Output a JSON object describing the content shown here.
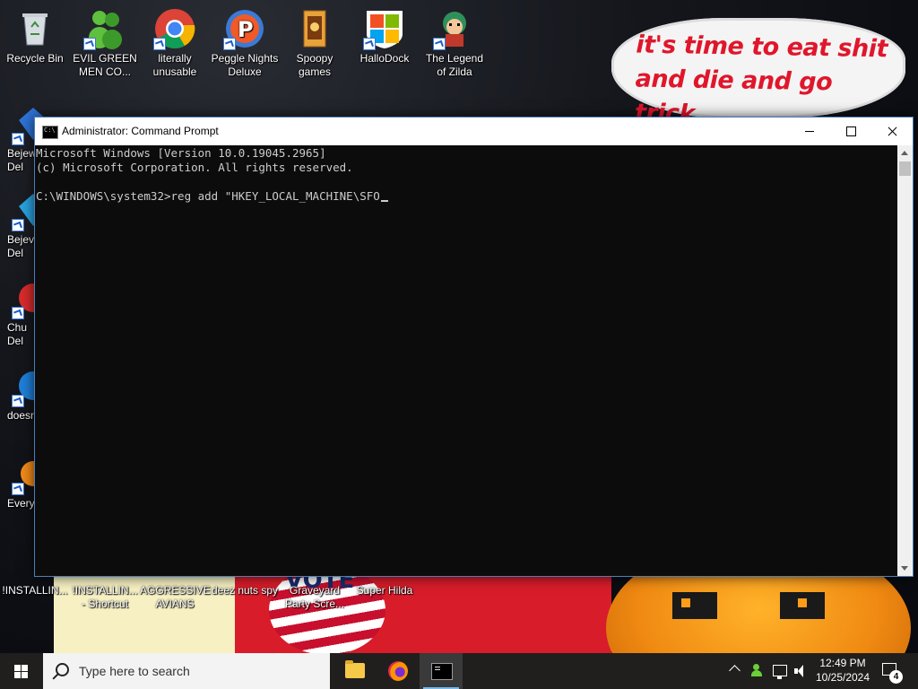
{
  "wallpaper": {
    "speech_text": "it's time to eat shit\nand die and go trick\nor treating and vote!",
    "vote_text": "VOTE"
  },
  "desktop": {
    "top_icons": [
      {
        "label": "Recycle Bin",
        "icon": "recycle-bin-icon"
      },
      {
        "label": "EVIL GREEN\nMEN CO...",
        "icon": "green-men-icon"
      },
      {
        "label": "literally\nunusable",
        "icon": "chrome-icon"
      },
      {
        "label": "Peggle Nights\nDeluxe",
        "icon": "peggle-icon"
      },
      {
        "label": "Spoopy\ngames",
        "icon": "games-folder-icon"
      },
      {
        "label": "HalloDock",
        "icon": "windows-logo-icon"
      },
      {
        "label": "The Legend\nof Zilda",
        "icon": "zilda-icon"
      }
    ],
    "left_icons": [
      {
        "label": "Bejew\nDel"
      },
      {
        "label": "Bejev\nDel"
      },
      {
        "label": "Chu\nDel"
      },
      {
        "label": "doesn"
      },
      {
        "label": "Every"
      }
    ],
    "bottom_icons": [
      {
        "label": "!INSTALLIN..."
      },
      {
        "label": "!INSTALLIN...\n- Shortcut"
      },
      {
        "label": "AGGRESSIVE\nAVIANS"
      },
      {
        "label": "deez nuts spy"
      },
      {
        "label": "Graveyard\nParty Scre..."
      },
      {
        "label": "Super Hilda"
      }
    ]
  },
  "cmd": {
    "title": "Administrator: Command Prompt",
    "lines": [
      "Microsoft Windows [Version 10.0.19045.2965]",
      "(c) Microsoft Corporation. All rights reserved.",
      "",
      "C:\\WINDOWS\\system32>reg add \"HKEY_LOCAL_MACHINE\\SFO"
    ],
    "colors": {
      "background": "#0c0c0c",
      "text": "#cccccc"
    }
  },
  "taskbar": {
    "search_placeholder": "Type here to search",
    "apps": [
      "file-explorer-icon",
      "firefox-icon",
      "command-prompt-icon"
    ],
    "clock_time": "12:49 PM",
    "clock_date": "10/25/2024",
    "notification_count": "4"
  }
}
